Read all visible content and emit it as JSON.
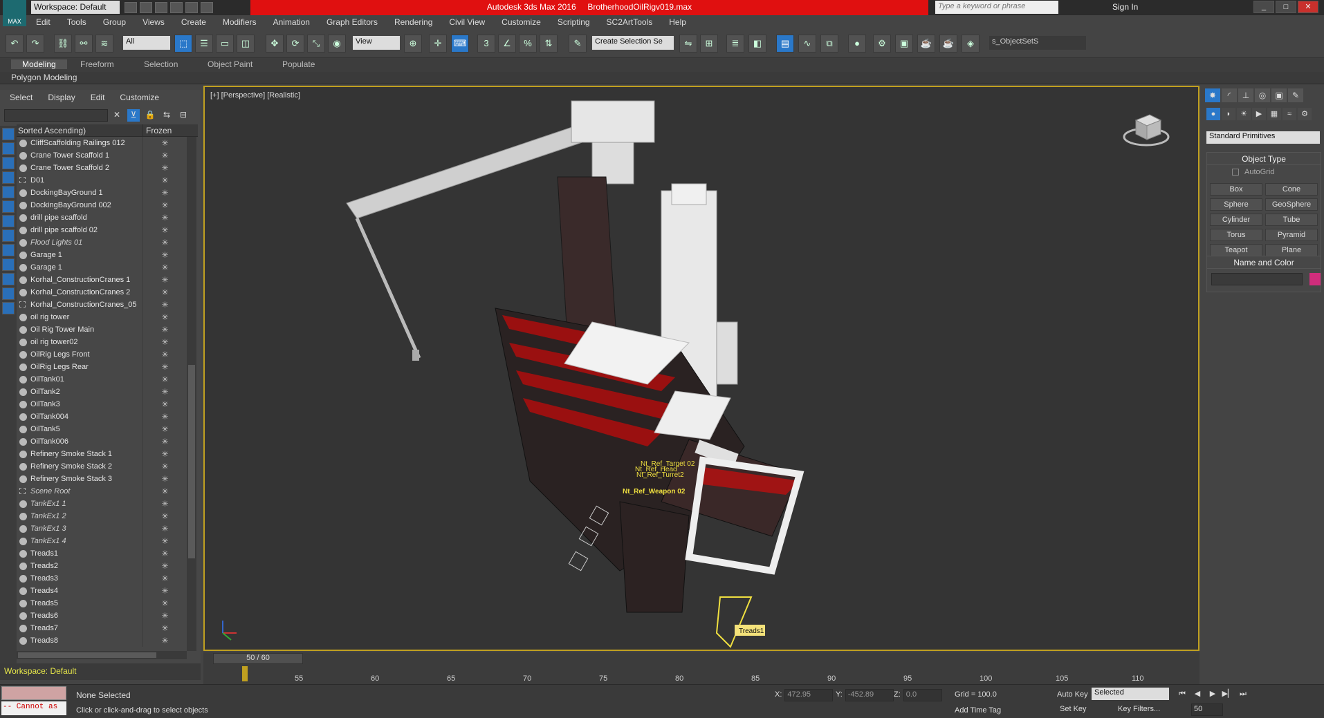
{
  "app": {
    "title_app": "Autodesk 3ds Max 2016",
    "title_file": "BrotherhoodOilRigv019.max",
    "logo_text": "MAX",
    "workspace": "Workspace: Default",
    "search_placeholder": "Type a keyword or phrase",
    "sign_in": "Sign In"
  },
  "menu": [
    "Edit",
    "Tools",
    "Group",
    "Views",
    "Create",
    "Modifiers",
    "Animation",
    "Graph Editors",
    "Rendering",
    "Civil View",
    "Customize",
    "Scripting",
    "SC2ArtTools",
    "Help"
  ],
  "toolbar": {
    "filter_dd": "All",
    "ref_coord_dd": "View",
    "selection_set_dd": "Create Selection Se",
    "objectset_label": "s_ObjectSetS"
  },
  "ribbon": {
    "tabs": [
      "Modeling",
      "Freeform",
      "Selection",
      "Object Paint",
      "Populate"
    ],
    "active_tab": "Modeling",
    "panel": "Polygon Modeling"
  },
  "explorer": {
    "menu": [
      "Select",
      "Display",
      "Edit",
      "Customize"
    ],
    "col_name": "Sorted Ascending)",
    "col_frozen": "Frozen",
    "workspace": "Workspace: Default",
    "rows": [
      {
        "name": "CliffScaffolding Railings 012",
        "style": "normal"
      },
      {
        "name": "Crane Tower Scaffold 1",
        "style": "normal"
      },
      {
        "name": "Crane Tower Scaffold 2",
        "style": "normal"
      },
      {
        "name": "D01",
        "style": "hidden"
      },
      {
        "name": "DockingBayGround 1",
        "style": "normal"
      },
      {
        "name": "DockingBayGround 002",
        "style": "normal"
      },
      {
        "name": "drill pipe scaffold",
        "style": "normal"
      },
      {
        "name": "drill pipe scaffold 02",
        "style": "normal"
      },
      {
        "name": "Flood Lights 01",
        "style": "italic"
      },
      {
        "name": "Garage 1",
        "style": "normal"
      },
      {
        "name": "Garage 1",
        "style": "normal"
      },
      {
        "name": "Korhal_ConstructionCranes 1",
        "style": "normal"
      },
      {
        "name": "Korhal_ConstructionCranes 2",
        "style": "normal"
      },
      {
        "name": "Korhal_ConstructionCranes_05",
        "style": "hidden"
      },
      {
        "name": "oil rig tower",
        "style": "normal"
      },
      {
        "name": "Oil Rig Tower Main",
        "style": "normal"
      },
      {
        "name": "oil rig tower02",
        "style": "normal"
      },
      {
        "name": "OilRig Legs Front",
        "style": "normal"
      },
      {
        "name": "OilRig Legs Rear",
        "style": "normal"
      },
      {
        "name": "OilTank01",
        "style": "normal"
      },
      {
        "name": "OilTank2",
        "style": "normal"
      },
      {
        "name": "OilTank3",
        "style": "normal"
      },
      {
        "name": "OilTank004",
        "style": "normal"
      },
      {
        "name": "OilTank5",
        "style": "normal"
      },
      {
        "name": "OilTank006",
        "style": "normal"
      },
      {
        "name": "Refinery Smoke Stack 1",
        "style": "normal"
      },
      {
        "name": "Refinery Smoke Stack 2",
        "style": "normal"
      },
      {
        "name": "Refinery Smoke Stack 3",
        "style": "normal"
      },
      {
        "name": "Scene Root",
        "style": "italic-hidden"
      },
      {
        "name": "TankEx1 1",
        "style": "italic"
      },
      {
        "name": "TankEx1 2",
        "style": "italic"
      },
      {
        "name": "TankEx1 3",
        "style": "italic"
      },
      {
        "name": "TankEx1 4",
        "style": "italic"
      },
      {
        "name": "Treads1",
        "style": "normal"
      },
      {
        "name": "Treads2",
        "style": "normal"
      },
      {
        "name": "Treads3",
        "style": "normal"
      },
      {
        "name": "Treads4",
        "style": "normal"
      },
      {
        "name": "Treads5",
        "style": "normal"
      },
      {
        "name": "Treads6",
        "style": "normal"
      },
      {
        "name": "Treads7",
        "style": "normal"
      },
      {
        "name": "Treads8",
        "style": "normal"
      }
    ]
  },
  "viewport": {
    "label": "[+] [Perspective] [Realistic]",
    "helpers": [
      "Nt_Ref_Target 02",
      "Nt_Ref_Head",
      "Nt_Ref_Turret2",
      "Nt_Ref_Weapon 02"
    ],
    "selected_label": "Treads1"
  },
  "timeline": {
    "slider": "50 / 60",
    "ticks": [
      "55",
      "60",
      "65",
      "70",
      "75",
      "80",
      "85",
      "90",
      "95",
      "100",
      "105",
      "110"
    ]
  },
  "command_panel": {
    "dropdown": "Standard Primitives",
    "object_type_title": "Object Type",
    "autogrid": "AutoGrid",
    "buttons": [
      "Box",
      "Cone",
      "Sphere",
      "GeoSphere",
      "Cylinder",
      "Tube",
      "Torus",
      "Pyramid",
      "Teapot",
      "Plane"
    ],
    "name_color_title": "Name and Color",
    "color": "#d02d7c"
  },
  "status": {
    "maxscript_error": "-- Cannot as",
    "selection": "None Selected",
    "prompt": "Click or click-and-drag to select objects",
    "x_value": "472.95",
    "y_value": "-452.89",
    "z_value": "0.0",
    "grid": "Grid = 100.0",
    "add_time_tag": "Add Time Tag",
    "auto_key": "Auto Key",
    "selected_dd": "Selected",
    "set_key": "Set Key",
    "key_filters": "Key Filters...",
    "frame": "50"
  }
}
